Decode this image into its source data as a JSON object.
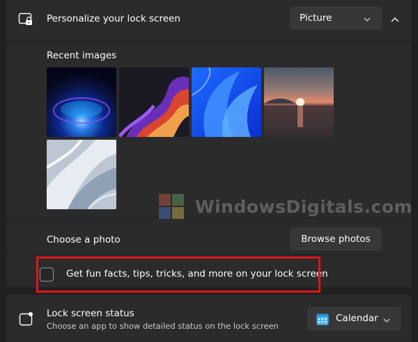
{
  "header": {
    "title": "Personalize your lock screen",
    "dropdown_value": "Picture",
    "icon": "lock-screen-icon"
  },
  "recent_images": {
    "label": "Recent images",
    "items": [
      {
        "name": "blue-glow-orb"
      },
      {
        "name": "purple-ribbons"
      },
      {
        "name": "blue-bloom"
      },
      {
        "name": "sunset-lake"
      },
      {
        "name": "white-waves"
      }
    ]
  },
  "choose_photo": {
    "label": "Choose a photo",
    "button": "Browse photos"
  },
  "fun_facts": {
    "label": "Get fun facts, tips, tricks, and more on your lock screen",
    "checked": false,
    "highlight_color": "#e0151b"
  },
  "status": {
    "title": "Lock screen status",
    "description": "Choose an app to show detailed status on the lock screen",
    "dropdown_value": "Calendar",
    "icon": "status-icon",
    "app_icon": "calendar-icon"
  },
  "watermark": {
    "text": "WindowsDigitals.com"
  },
  "colors": {
    "background": "#202020",
    "card": "#2b2b2b",
    "accent": "#e0151b"
  }
}
